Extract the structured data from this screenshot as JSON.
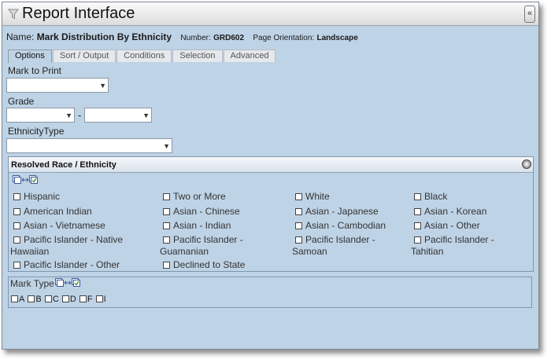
{
  "window": {
    "title": "Report Interface",
    "collapse_glyph": "«"
  },
  "report": {
    "name_label": "Name:",
    "name_value": "Mark Distribution By Ethnicity",
    "number_label": "Number:",
    "number_value": "GRD602",
    "orientation_label": "Page Orientation:",
    "orientation_value": "Landscape"
  },
  "tabs": [
    {
      "label": "Options"
    },
    {
      "label": "Sort / Output"
    },
    {
      "label": "Conditions"
    },
    {
      "label": "Selection"
    },
    {
      "label": "Advanced"
    }
  ],
  "fields": {
    "mark_to_print_label": "Mark to Print",
    "grade_label": "Grade",
    "grade_separator": "-",
    "ethnicity_type_label": "EthnicityType",
    "mark_to_print_value": "",
    "grade_from_value": "",
    "grade_to_value": "",
    "ethnicity_type_value": ""
  },
  "race_panel": {
    "title": "Resolved Race / Ethnicity",
    "options": [
      [
        "Hispanic",
        "Two or More",
        "White",
        "Black"
      ],
      [
        "American Indian",
        "Asian - Chinese",
        "Asian - Japanese",
        "Asian - Korean"
      ],
      [
        "Asian - Vietnamese",
        "Asian - Indian",
        "Asian - Cambodian",
        "Asian - Other"
      ],
      [
        {
          "line1": "Pacific Islander - Native",
          "line2": "Hawaiian"
        },
        {
          "line1": "Pacific Islander -",
          "line2": "Guamanian"
        },
        {
          "line1": "Pacific Islander -",
          "line2": "Samoan"
        },
        {
          "line1": "Pacific Islander -",
          "line2": "Tahitian"
        }
      ],
      [
        "Pacific Islander - Other",
        "Declined to State"
      ]
    ]
  },
  "mark_type": {
    "label": "Mark Type",
    "options": [
      "A",
      "B",
      "C",
      "D",
      "F",
      "I"
    ]
  },
  "icons": {
    "filter": "funnel-icon",
    "collapse": "double-chevron-left-icon",
    "panel_toggle": "circle-toggle-icon",
    "select_all": "select-all-toggle-icon"
  }
}
